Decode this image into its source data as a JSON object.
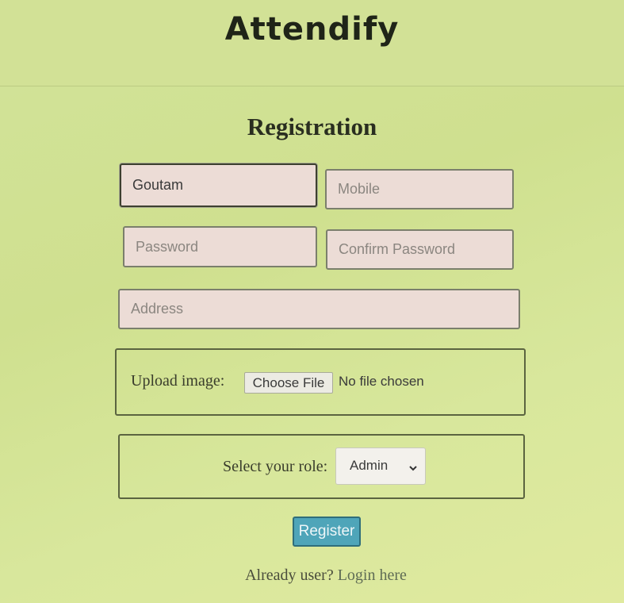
{
  "app": {
    "title": "Attendify"
  },
  "form": {
    "title": "Registration",
    "name": {
      "value": "Goutam",
      "placeholder": ""
    },
    "mobile": {
      "value": "",
      "placeholder": "Mobile"
    },
    "password": {
      "value": "",
      "placeholder": "Password"
    },
    "confirm_password": {
      "value": "",
      "placeholder": "Confirm Password"
    },
    "address": {
      "value": "",
      "placeholder": "Address"
    },
    "upload": {
      "label": "Upload image:",
      "button_label": "Choose File",
      "status": "No file chosen"
    },
    "role": {
      "label": "Select your role:",
      "selected": "Admin"
    },
    "register_label": "Register",
    "footer": {
      "prompt": "Already user?",
      "link": "Login here"
    }
  },
  "colors": {
    "background": "#d2e196",
    "field_fill": "#ecdcd6",
    "register_button": "#4fa5b9"
  }
}
